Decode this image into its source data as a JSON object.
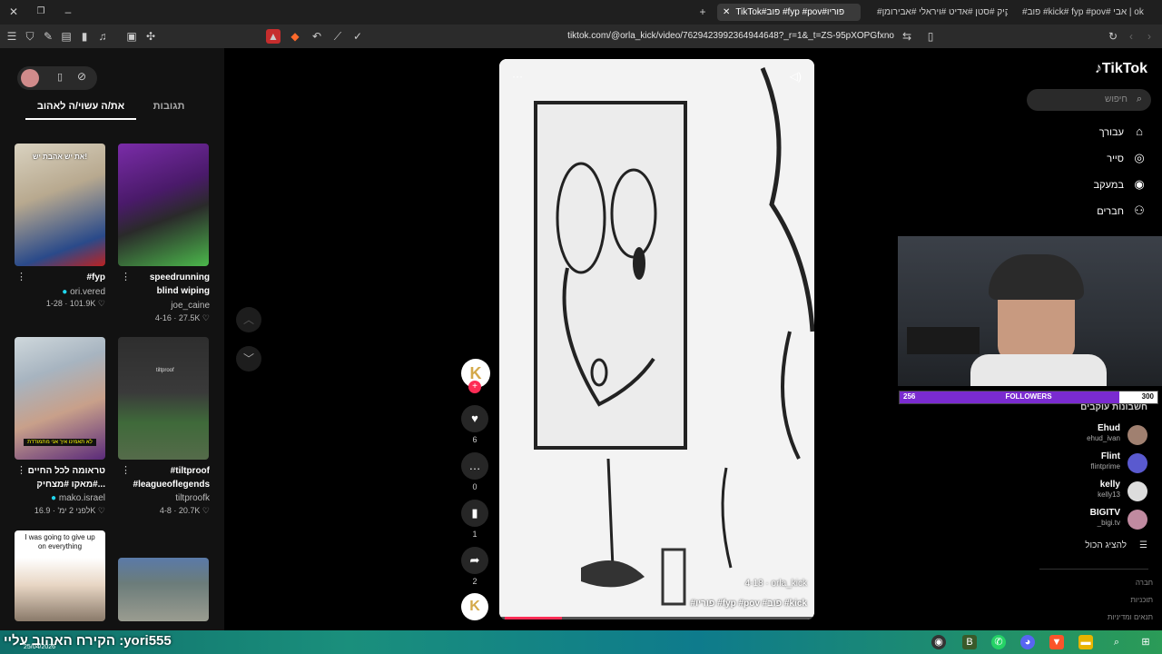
{
  "browser": {
    "tabs": [
      {
        "label": "TikTok#פוב #fyp #pov#פוריו"
      },
      {
        "label": "#קיק #סטן #אדיט #ויראלי #אבירומן"
      },
      {
        "label": "#פוב #kick# fyp #pov# אבי | ok"
      }
    ],
    "url": "tiktok.com/@orla_kick/video/7629423992364944648?_r=1&_t=ZS-95pXOPGfxno"
  },
  "left_panel": {
    "tabs": [
      {
        "label": "תגובות"
      },
      {
        "label": "את/ה עשוי/ה לאהוב"
      }
    ],
    "videos": [
      {
        "title": "#fyp",
        "author": "ori.vered",
        "stats": "1-28 · 101.9K ♡",
        "thumb_text": "את יש אהבת יש!"
      },
      {
        "title": "speedrunning blind wiping",
        "author": "joe_caine",
        "stats": "4-16 · 27.5K ♡",
        "thumb_text": ""
      },
      {
        "title": "טראומה לכל החיים #מאקו #מצחיק...",
        "author": "mako.israel",
        "stats": "לפני 2 ימ' · 16.9K ♡",
        "thumb_text": "לא תאמינו איך אני מתמודדת"
      },
      {
        "title": "#tiltproof #leagueoflegends",
        "author": "tiltproofk",
        "stats": "4-8 · 20.7K ♡",
        "thumb_text": "tiltproof"
      },
      {
        "title": "",
        "author": "",
        "stats": "",
        "thumb_text": "I was going to give up on everything"
      },
      {
        "title": "",
        "author": "",
        "stats": "",
        "thumb_text": ""
      }
    ]
  },
  "video": {
    "username": "orla_kick",
    "date": "4-18",
    "caption": "#פוריו #fyp #pov #פוב #kick"
  },
  "actions": {
    "likes": "6",
    "comments": "0",
    "saves": "1",
    "shares": "2"
  },
  "right_nav": {
    "logo": "TikTok",
    "search_placeholder": "חיפוש",
    "items": [
      {
        "label": "עבורך",
        "icon": "home-icon"
      },
      {
        "label": "סייר",
        "icon": "compass-icon"
      },
      {
        "label": "במעקב",
        "icon": "following-icon"
      },
      {
        "label": "חברים",
        "icon": "friends-icon"
      }
    ],
    "following_title": "חשבונות עוקבים",
    "following": [
      {
        "name": "Ehud",
        "handle": "ehud_ivan"
      },
      {
        "name": "Flint",
        "handle": "flintprime"
      },
      {
        "name": "kelly",
        "handle": "kelly13"
      },
      {
        "name": "BIGITV",
        "handle": "_bigi.tv"
      }
    ],
    "show_all": "להציג הכול",
    "footer": [
      "חברה",
      "תוכניות",
      "תנאים ומדיניות"
    ]
  },
  "stream_overlay": {
    "followers_current": "256",
    "followers_goal": "300",
    "followers_label": "FOLLOWERS",
    "followers_fraction": 0.853,
    "ticker": "הקירח האהוב עליי :yori555",
    "date": "25/04/2026"
  },
  "colors": {
    "accent": "#fe2c55",
    "followers_bar": "#7a2bd0"
  }
}
